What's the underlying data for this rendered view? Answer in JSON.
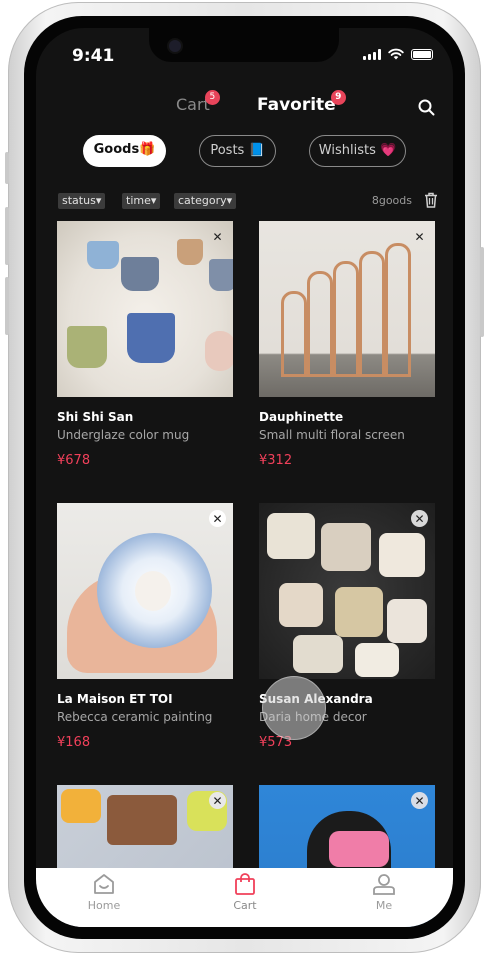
{
  "status_bar": {
    "time": "9:41"
  },
  "header": {
    "tabs": [
      {
        "label": "Cart",
        "badge": "5"
      },
      {
        "label": "Favorite",
        "badge": "9"
      }
    ],
    "search_icon": "search-icon"
  },
  "segments": [
    {
      "label": "Goods",
      "emoji": "🎁"
    },
    {
      "label": "Posts",
      "emoji": "📘"
    },
    {
      "label": "Wishlists",
      "emoji": "💗"
    }
  ],
  "filters": {
    "chips": [
      "status",
      "time",
      "category"
    ],
    "count": "8goods"
  },
  "products": [
    {
      "brand": "Shi Shi San",
      "desc": "Underglaze color mug",
      "price": "¥678"
    },
    {
      "brand": "Dauphinette",
      "desc": "Small multi floral screen",
      "price": "¥312"
    },
    {
      "brand": "La Maison ET TOI",
      "desc": "Rebecca ceramic painting",
      "price": "¥168"
    },
    {
      "brand": "Susan Alexandra",
      "desc": "Daria home decor",
      "price": "¥573"
    }
  ],
  "tab_bar": [
    {
      "label": "Home",
      "icon": "home-icon"
    },
    {
      "label": "Cart",
      "icon": "bag-icon"
    },
    {
      "label": "Me",
      "icon": "person-icon"
    }
  ],
  "colors": {
    "accent": "#f0405a",
    "background": "#131313",
    "badge": "#e8445a"
  }
}
